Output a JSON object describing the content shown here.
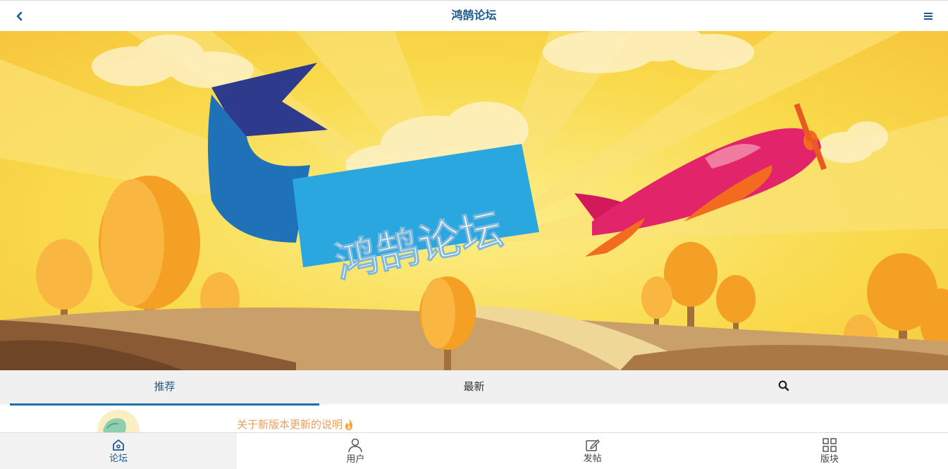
{
  "header": {
    "title": "鸿鹄论坛",
    "back_icon": "chevron-left-icon",
    "menu_icon": "hamburger-menu-icon"
  },
  "banner": {
    "banner_text": "鸿鹄论坛"
  },
  "tabs": [
    {
      "label": "推荐",
      "active": true
    },
    {
      "label": "最新",
      "active": false
    },
    {
      "label": "",
      "icon": "search-icon",
      "active": false
    }
  ],
  "posts": [
    {
      "title": "关于新版本更新的说明",
      "badge_icon": "flame-icon"
    }
  ],
  "bottom_nav": [
    {
      "label": "论坛",
      "icon": "home-icon",
      "active": true
    },
    {
      "label": "用户",
      "icon": "user-icon",
      "active": false
    },
    {
      "label": "发帖",
      "icon": "edit-icon",
      "active": false
    },
    {
      "label": "版块",
      "icon": "grid-icon",
      "active": false
    }
  ],
  "colors": {
    "accent": "#1f5a8c",
    "tab_underline": "#1f6fb0",
    "post_title": "#e8a060"
  }
}
